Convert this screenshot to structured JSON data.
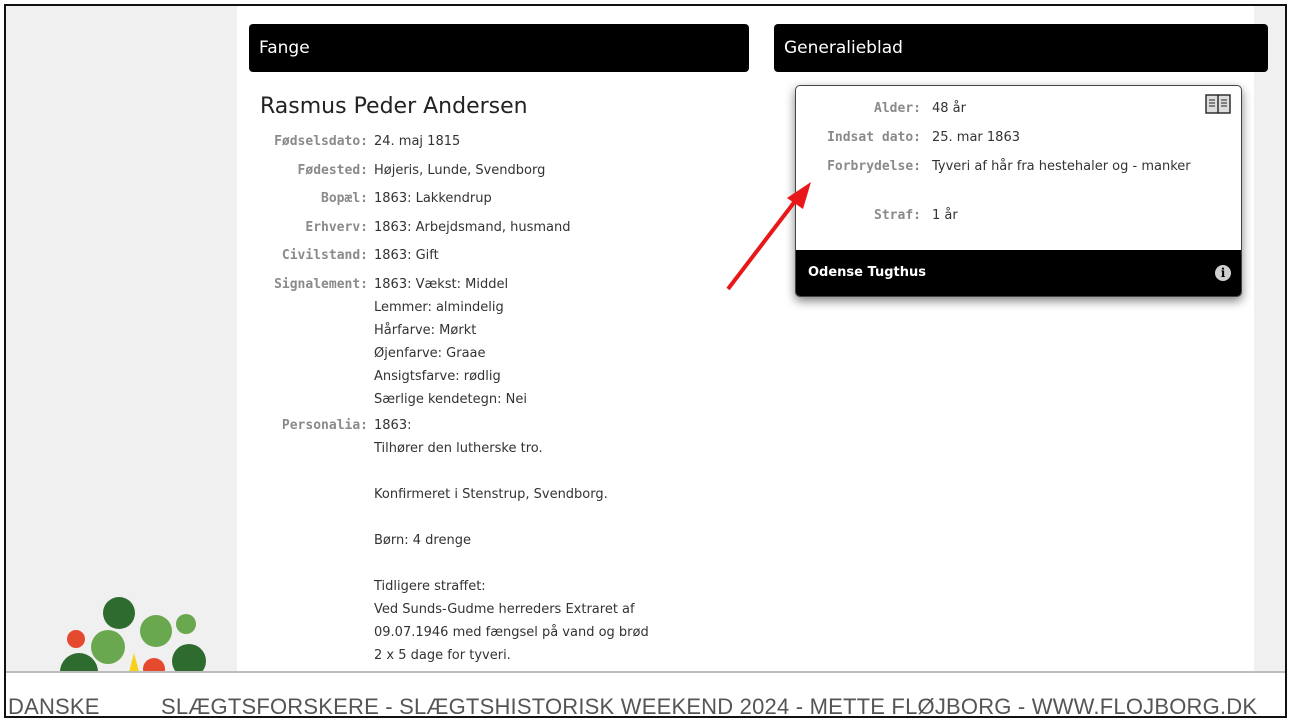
{
  "headers": {
    "left": "Fange",
    "right": "Generalieblad"
  },
  "person": {
    "name": "Rasmus Peder Andersen",
    "fields": [
      {
        "label": "Fødselsdato:",
        "value": "24. maj 1815"
      },
      {
        "label": "Fødested:",
        "value": "Højeris, Lunde, Svendborg"
      },
      {
        "label": "Bopæl:",
        "value": "1863: Lakkendrup"
      },
      {
        "label": "Erhverv:",
        "value": "1863: Arbejdsmand, husmand"
      },
      {
        "label": "Civilstand:",
        "value": "1863: Gift"
      },
      {
        "label": "Signalement:",
        "value": "1863: Vækst: Middel\nLemmer: almindelig\nHårfarve: Mørkt\nØjenfarve: Graae\nAnsigtsfarve: rødlig\nSærlige kendetegn: Nei"
      },
      {
        "label": "Personalia:",
        "value": "1863:\nTilhører den lutherske tro.\n\nKonfirmeret i Stenstrup, Svendborg.\n\nBørn: 4 drenge\n\nTidligere straffet:\nVed Sunds-Gudme herreders Extraret af\n09.07.1946 med fængsel på vand og brød\n2 x 5 dage for tyveri."
      }
    ]
  },
  "card": {
    "fields": [
      {
        "label": "Alder:",
        "value": "48 år"
      },
      {
        "label": "Indsat dato:",
        "value": "25. mar 1863"
      },
      {
        "label": "Forbrydelse:",
        "value": "Tyveri af hår fra hestehaler og - manker"
      },
      {
        "label": "Straf:",
        "value": "1 år"
      }
    ],
    "footer": "Odense Tugthus",
    "icon_top": "book-icon",
    "icon_footer": "info-icon"
  },
  "banner": {
    "part1": "DANSKE",
    "part2": "SLÆGTSFORSKERE - SLÆGTSHISTORISK WEEKEND 2024 - METTE FLØJBORG  - WWW.FLOJBORG.DK"
  },
  "colors": {
    "arrow": "#e8181a",
    "logo_dark": "#2e6b2f",
    "logo_mid": "#6aa84f",
    "logo_red": "#e64a2e",
    "logo_yellow": "#f7d117"
  }
}
